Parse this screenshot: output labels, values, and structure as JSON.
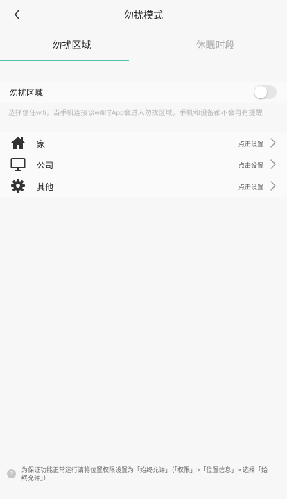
{
  "header": {
    "title": "勿扰模式",
    "back_icon": "chevron-left-icon"
  },
  "tabs": [
    {
      "label": "勿扰区域",
      "active": true
    },
    {
      "label": "休眠时段",
      "active": false
    }
  ],
  "accent_color": "#4fc2b1",
  "zone_toggle": {
    "label": "勿扰区域",
    "enabled": false
  },
  "hint": "选择信任wifi，当手机连接该wifi时App会进入勿扰区域，手机和设备都不会再有提醒",
  "locations": [
    {
      "icon": "home-icon",
      "label": "家",
      "action": "点击设置"
    },
    {
      "icon": "monitor-icon",
      "label": "公司",
      "action": "点击设置"
    },
    {
      "icon": "gear-icon",
      "label": "其他",
      "action": "点击设置"
    }
  ],
  "footer": {
    "icon_glyph": "?",
    "text": "为保证功能正常运行请将位置权限设置为「始终允许」（「权限」>「位置信息」> 选择「始终允许」）"
  }
}
